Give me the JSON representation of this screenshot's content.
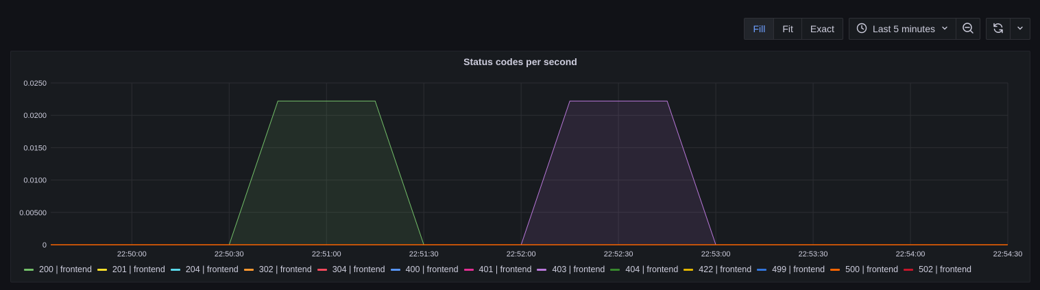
{
  "toolbar": {
    "view_modes": [
      "Fill",
      "Fit",
      "Exact"
    ],
    "active_view": "Fill",
    "time_range": "Last 5 minutes"
  },
  "panel": {
    "title": "Status codes per second"
  },
  "chart_data": {
    "type": "area",
    "title": "Status codes per second",
    "x_ticks": [
      "22:50:00",
      "22:50:30",
      "22:51:00",
      "22:51:30",
      "22:52:00",
      "22:52:30",
      "22:53:00",
      "22:53:30",
      "22:54:00",
      "22:54:30"
    ],
    "y_ticks": [
      "0",
      "0.00500",
      "0.0100",
      "0.0150",
      "0.0200",
      "0.0250"
    ],
    "xlim": [
      "22:49:35",
      "22:54:30"
    ],
    "ylim": [
      0,
      0.025
    ],
    "grid": true,
    "legend_position": "bottom",
    "series": [
      {
        "name": "200 | frontend",
        "color": "#73bf69",
        "x": [
          "22:49:35",
          "22:50:30",
          "22:50:45",
          "22:51:15",
          "22:51:30",
          "22:54:30"
        ],
        "values": [
          0,
          0,
          0.0222,
          0.0222,
          0,
          0
        ]
      },
      {
        "name": "201 | frontend",
        "color": "#fade2a",
        "x": [],
        "values": []
      },
      {
        "name": "204 | frontend",
        "color": "#5ad7e8",
        "x": [],
        "values": []
      },
      {
        "name": "302 | frontend",
        "color": "#ff9830",
        "x": [],
        "values": []
      },
      {
        "name": "304 | frontend",
        "color": "#f2495c",
        "x": [],
        "values": []
      },
      {
        "name": "400 | frontend",
        "color": "#5794f2",
        "x": [],
        "values": []
      },
      {
        "name": "401 | frontend",
        "color": "#e02f92",
        "x": [],
        "values": []
      },
      {
        "name": "403 | frontend",
        "color": "#b877d9",
        "x": [
          "22:49:35",
          "22:52:00",
          "22:52:15",
          "22:52:45",
          "22:53:00",
          "22:54:30"
        ],
        "values": [
          0,
          0,
          0.0222,
          0.0222,
          0,
          0
        ]
      },
      {
        "name": "404 | frontend",
        "color": "#37872d",
        "x": [],
        "values": []
      },
      {
        "name": "422 | frontend",
        "color": "#e0b400",
        "x": [],
        "values": []
      },
      {
        "name": "499 | frontend",
        "color": "#3274d9",
        "x": [],
        "values": []
      },
      {
        "name": "500 | frontend",
        "color": "#fa6400",
        "x": [],
        "values": []
      },
      {
        "name": "502 | frontend",
        "color": "#c4162a",
        "x": [],
        "values": []
      }
    ]
  }
}
